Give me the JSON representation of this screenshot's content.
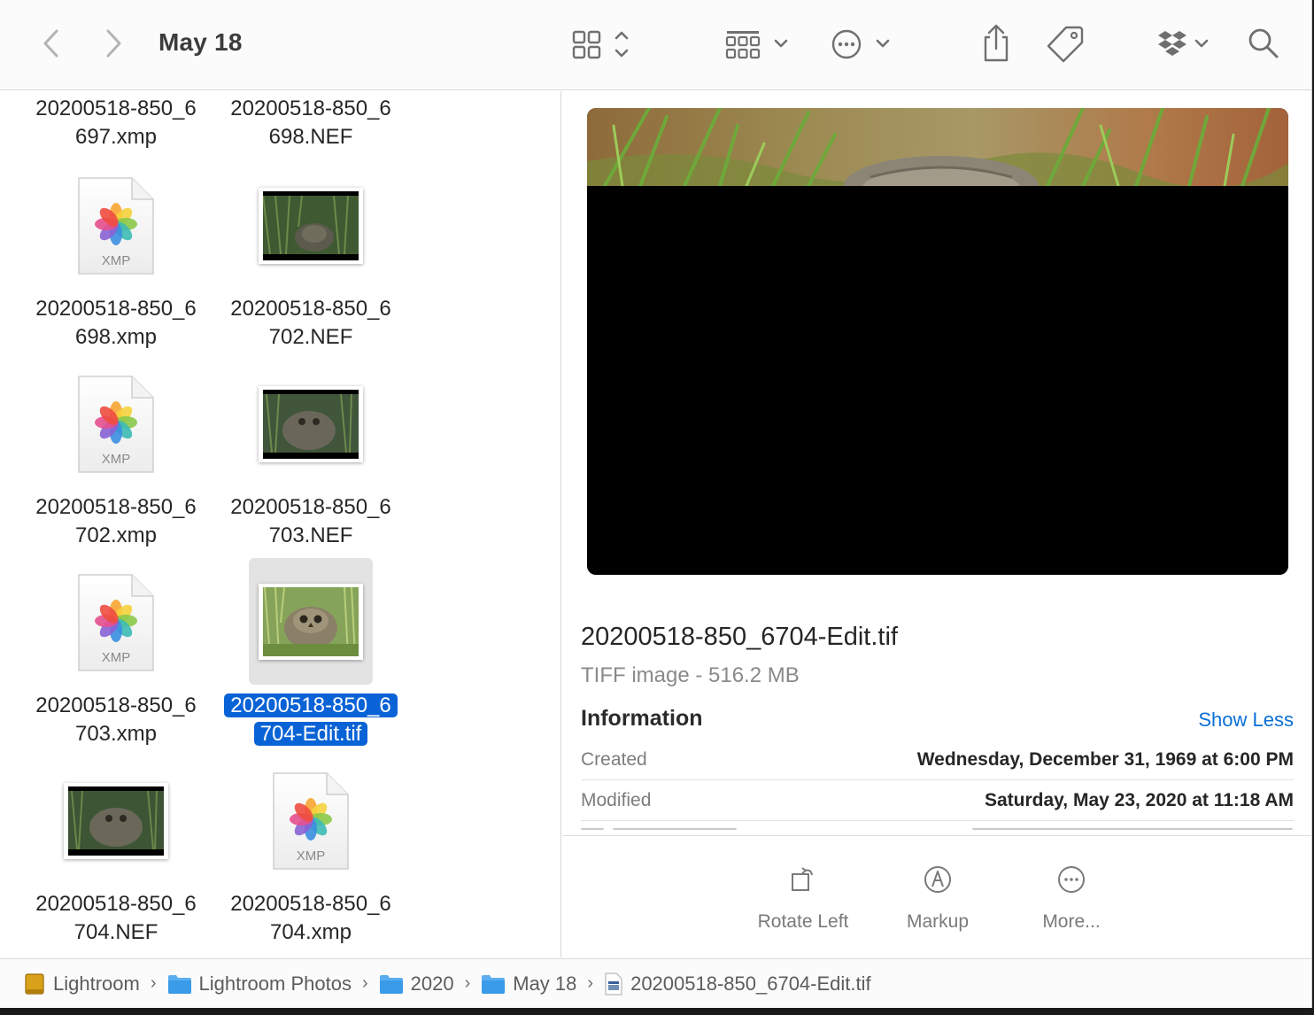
{
  "toolbar": {
    "title": "May 18",
    "icons": [
      "chevron-left-icon",
      "chevron-right-icon",
      "grid-view-icon",
      "group-icon",
      "action-ellipsis-icon",
      "share-icon",
      "tag-icon",
      "dropbox-icon",
      "search-icon"
    ]
  },
  "files": [
    {
      "line1": "20200518-850_6",
      "line2": "697.xmp",
      "kind": "xmp"
    },
    {
      "line1": "20200518-850_6",
      "line2": "698.NEF",
      "kind": "nef"
    },
    {
      "line1": "20200518-850_6",
      "line2": "698.xmp",
      "kind": "xmp",
      "badge": "XMP"
    },
    {
      "line1": "20200518-850_6",
      "line2": "702.NEF",
      "kind": "nef"
    },
    {
      "line1": "20200518-850_6",
      "line2": "702.xmp",
      "kind": "xmp",
      "badge": "XMP"
    },
    {
      "line1": "20200518-850_6",
      "line2": "703.NEF",
      "kind": "nef"
    },
    {
      "line1": "20200518-850_6",
      "line2": "703.xmp",
      "kind": "xmp",
      "badge": "XMP"
    },
    {
      "line1": "20200518-850_6",
      "line2": "704-Edit.tif",
      "kind": "tif",
      "selected": true
    },
    {
      "line1": "20200518-850_6",
      "line2": "704.NEF",
      "kind": "nef"
    },
    {
      "line1": "20200518-850_6",
      "line2": "704.xmp",
      "kind": "xmp",
      "badge": "XMP"
    }
  ],
  "preview": {
    "filename": "20200518-850_6704-Edit.tif",
    "kind": "TIFF image - 516.2 MB",
    "info_title": "Information",
    "show_less": "Show Less",
    "rows": [
      {
        "key": "Created",
        "value": "Wednesday, December 31, 1969 at 6:00 PM"
      },
      {
        "key": "Modified",
        "value": "Saturday, May 23, 2020 at 11:18 AM"
      }
    ],
    "actions": [
      {
        "label": "Rotate Left",
        "icon": "rotate-left-icon"
      },
      {
        "label": "Markup",
        "icon": "markup-icon"
      },
      {
        "label": "More...",
        "icon": "more-ellipsis-icon"
      }
    ]
  },
  "pathbar": {
    "crumbs": [
      {
        "label": "Lightroom",
        "icon": "drive-icon"
      },
      {
        "label": "Lightroom Photos",
        "icon": "folder-icon"
      },
      {
        "label": "2020",
        "icon": "folder-icon"
      },
      {
        "label": "May 18",
        "icon": "folder-icon"
      },
      {
        "label": "20200518-850_6704-Edit.tif",
        "icon": "tiff-file-icon"
      }
    ]
  },
  "colors": {
    "selection": "#0a63d6",
    "link": "#0a6fd6",
    "folder": "#3a9be8"
  }
}
